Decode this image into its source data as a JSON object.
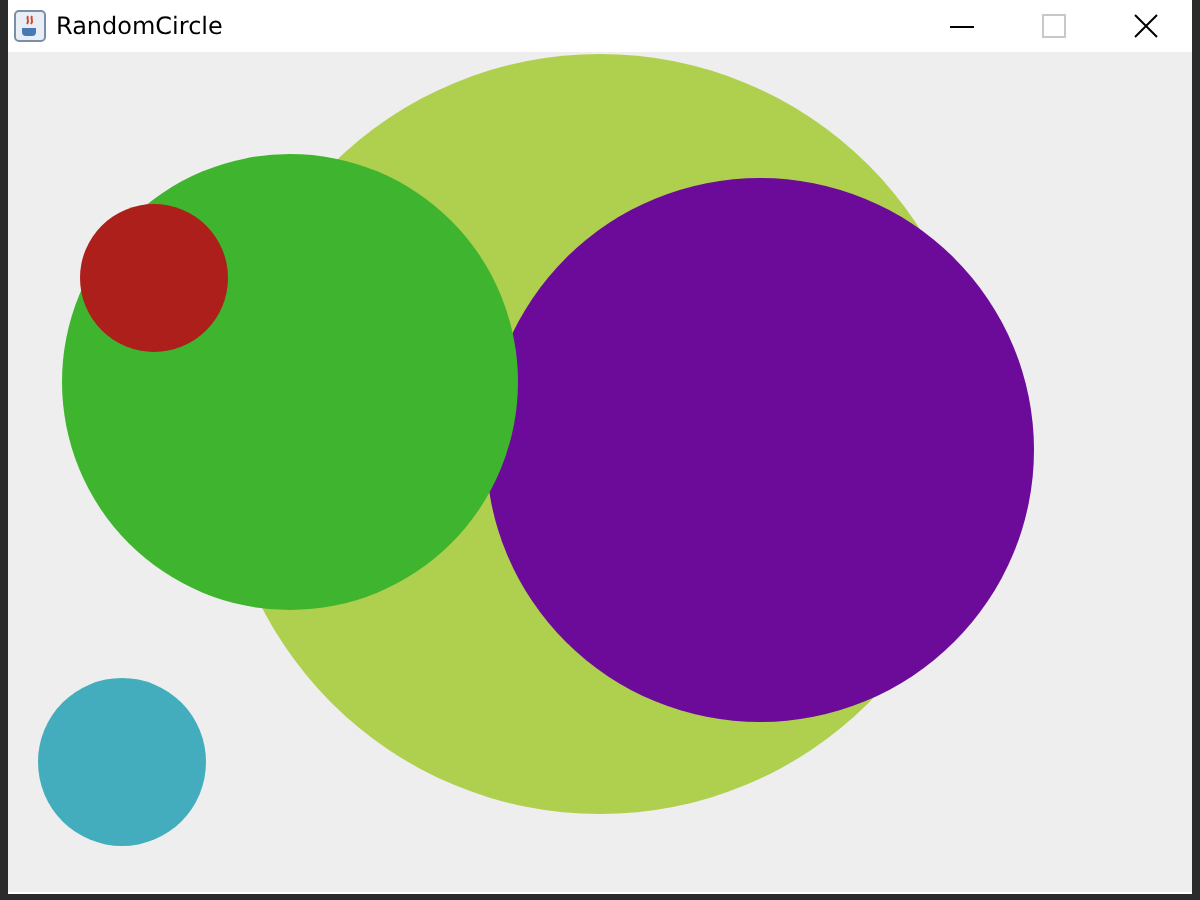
{
  "window": {
    "title": "RandomCircle",
    "controls": [
      {
        "kind": "minimize",
        "disabled": false
      },
      {
        "kind": "maximize",
        "disabled": true
      },
      {
        "kind": "close",
        "disabled": false
      }
    ]
  },
  "circles": [
    {
      "color": "#aed04e"
    },
    {
      "color": "#6c0b99"
    },
    {
      "color": "#3fb42f"
    },
    {
      "color": "#ad1f1b"
    },
    {
      "color": "#43adbd"
    }
  ]
}
